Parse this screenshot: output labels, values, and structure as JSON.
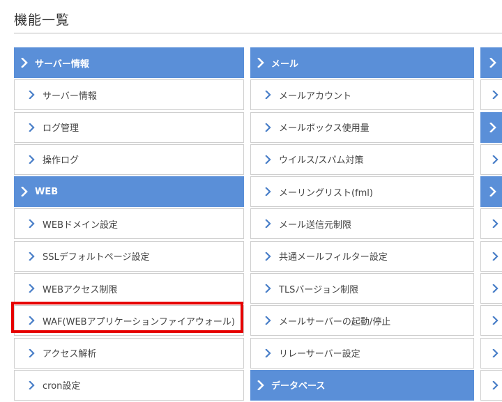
{
  "page": {
    "title": "機能一覧"
  },
  "colors": {
    "header_bg": "#5a8fd8",
    "header_text": "#ffffff",
    "link_chevron": "#4a7fc8",
    "link_border": "#cfcfcf",
    "highlight": "#e60000"
  },
  "icons": {
    "chevron": "chevron-right-icon"
  },
  "columns": [
    {
      "items": [
        {
          "type": "header",
          "label": "サーバー情報"
        },
        {
          "type": "link",
          "label": "サーバー情報"
        },
        {
          "type": "link",
          "label": "ログ管理"
        },
        {
          "type": "link",
          "label": "操作ログ"
        },
        {
          "type": "header",
          "label": "WEB"
        },
        {
          "type": "link",
          "label": "WEBドメイン設定"
        },
        {
          "type": "link",
          "label": "SSLデフォルトページ設定"
        },
        {
          "type": "link",
          "label": "WEBアクセス制限"
        },
        {
          "type": "link",
          "label": "WAF(WEBアプリケーションファイアウォール)",
          "highlighted": true
        },
        {
          "type": "link",
          "label": "アクセス解析"
        },
        {
          "type": "link",
          "label": "cron設定"
        }
      ]
    },
    {
      "items": [
        {
          "type": "header",
          "label": "メール"
        },
        {
          "type": "link",
          "label": "メールアカウント"
        },
        {
          "type": "link",
          "label": "メールボックス使用量"
        },
        {
          "type": "link",
          "label": "ウイルス/スパム対策"
        },
        {
          "type": "link",
          "label": "メーリングリスト(fml)"
        },
        {
          "type": "link",
          "label": "メール送信元制限"
        },
        {
          "type": "link",
          "label": "共通メールフィルター設定"
        },
        {
          "type": "link",
          "label": "TLSバージョン制限"
        },
        {
          "type": "link",
          "label": "メールサーバーの起動/停止"
        },
        {
          "type": "link",
          "label": "リレーサーバー設定"
        },
        {
          "type": "header",
          "label": "データベース"
        }
      ]
    },
    {
      "items": [
        {
          "type": "header",
          "label": ""
        },
        {
          "type": "link",
          "label": ""
        },
        {
          "type": "header",
          "label": ""
        },
        {
          "type": "link",
          "label": ""
        },
        {
          "type": "header",
          "label": ""
        },
        {
          "type": "link",
          "label": ""
        },
        {
          "type": "link",
          "label": ""
        },
        {
          "type": "link",
          "label": ""
        },
        {
          "type": "link",
          "label": ""
        },
        {
          "type": "link",
          "label": ""
        },
        {
          "type": "link",
          "label": ""
        }
      ]
    }
  ]
}
